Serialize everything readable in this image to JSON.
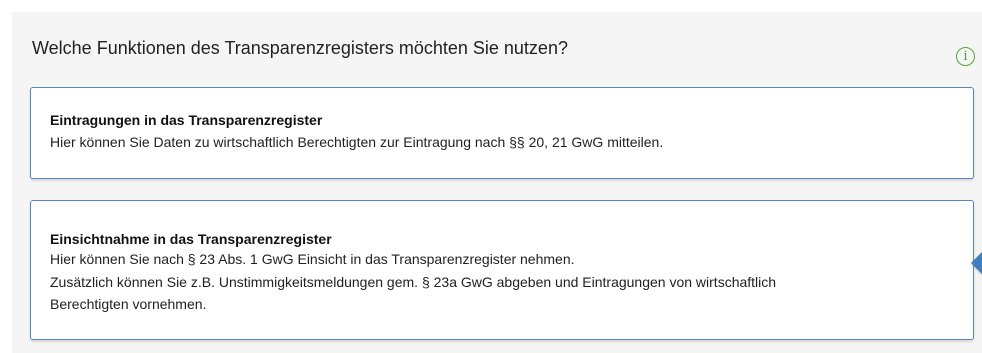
{
  "question": "Welche Funktionen des Transparenzregisters möchten Sie nutzen?",
  "info_icon": {
    "glyph": "i",
    "color": "#56a33b",
    "name": "info-icon"
  },
  "options": [
    {
      "title": "Eintragungen in das Transparenzregister",
      "lines": [
        "Hier können Sie Daten zu wirtschaftlich Berechtigten zur Eintragung nach §§ 20, 21 GwG mitteilen."
      ]
    },
    {
      "title": "Einsichtnahme in das Transparenzregister",
      "lines": [
        "Hier können Sie nach § 23 Abs. 1 GwG Einsicht in das Transparenzregister nehmen.",
        "Zusätzlich können Sie z.B. Unstimmigkeitsmeldungen gem. § 23a GwG abgeben und Eintragungen von wirtschaftlich",
        "Berechtigten vornehmen."
      ]
    }
  ],
  "colors": {
    "panel_background": "#f5f5f5",
    "card_border": "#5a87b8",
    "pointer": "#3f7fc0"
  }
}
